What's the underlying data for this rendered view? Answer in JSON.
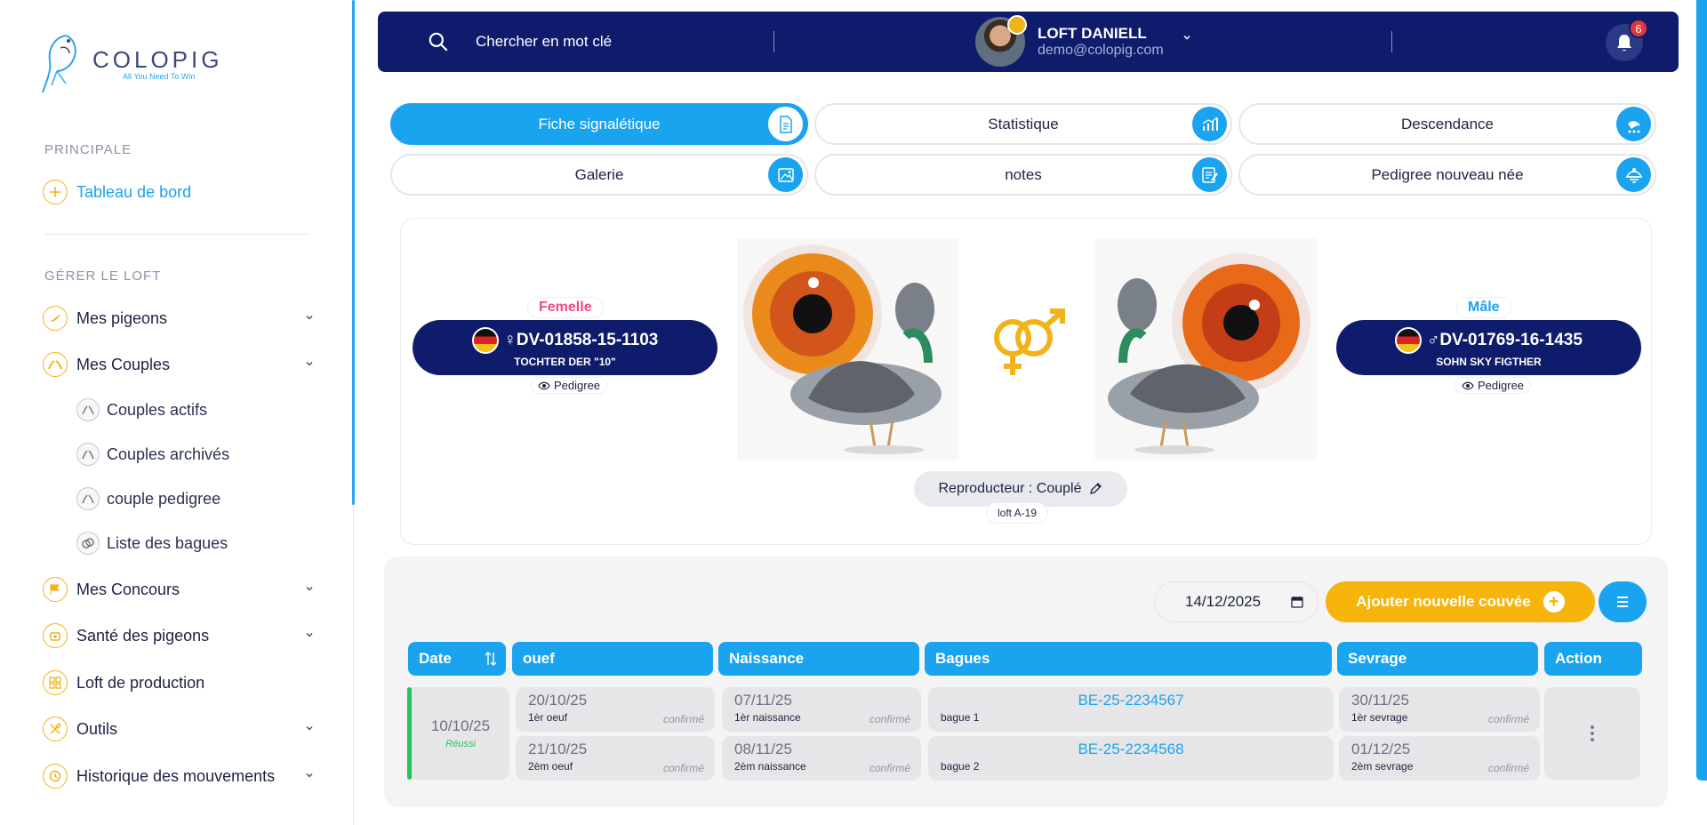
{
  "brand": {
    "title": "COLOPIG",
    "tagline": "All You Need To Win"
  },
  "sidebar": {
    "section_main": "PRINCIPALE",
    "dashboard": "Tableau de bord",
    "section_loft": "GÉRER LE LOFT",
    "items": [
      {
        "label": "Mes pigeons"
      },
      {
        "label": "Mes Couples"
      },
      {
        "label": "Mes Concours"
      },
      {
        "label": "Santé des pigeons"
      },
      {
        "label": "Loft de production"
      },
      {
        "label": "Outils"
      },
      {
        "label": "Historique des mouvements"
      }
    ],
    "couples_sub": [
      {
        "label": "Couples actifs"
      },
      {
        "label": "Couples archivés"
      },
      {
        "label": "couple pedigree"
      },
      {
        "label": "Liste des bagues"
      }
    ]
  },
  "topbar": {
    "search_placeholder": "Chercher en mot clé",
    "user_name": "LOFT DANIELL",
    "user_email": "demo@colopig.com",
    "notifications": "6"
  },
  "tabs": [
    {
      "label": "Fiche signalétique",
      "icon": "document-icon",
      "active": true
    },
    {
      "label": "Statistique",
      "icon": "chart-icon"
    },
    {
      "label": "Descendance",
      "icon": "descendance-icon"
    },
    {
      "label": "Galerie",
      "icon": "gallery-icon"
    },
    {
      "label": "notes",
      "icon": "notes-icon"
    },
    {
      "label": "Pedigree nouveau née",
      "icon": "pedigree-icon"
    }
  ],
  "couple": {
    "female": {
      "sex_label": "Femelle",
      "ring": "♀DV-01858-15-1103",
      "name": "TOCHTER DER \"10\"",
      "pedigree": "Pedigree"
    },
    "male": {
      "sex_label": "Mâle",
      "ring": "♂DV-01769-16-1435",
      "name": "SOHN SKY FIGTHER",
      "pedigree": "Pedigree"
    },
    "status": "Reproducteur : Couplé",
    "loft": "loft A-19"
  },
  "brood": {
    "date_value": "14/12/2025",
    "add_button": "Ajouter nouvelle couvée",
    "headers": [
      "Date",
      "ouef",
      "Naissance",
      "Bagues",
      "Sevrage",
      "Action"
    ],
    "row": {
      "date": "10/10/25",
      "status": "Réussi",
      "eggs": [
        {
          "value": "20/10/25",
          "label": "1èr oeuf",
          "state": "confirmé"
        },
        {
          "value": "21/10/25",
          "label": "2èm oeuf",
          "state": "confirmé"
        }
      ],
      "births": [
        {
          "value": "07/11/25",
          "label": "1èr naissance",
          "state": "confirmé"
        },
        {
          "value": "08/11/25",
          "label": "2èm naissance",
          "state": "confirmé"
        }
      ],
      "rings": [
        {
          "value": "BE-25-2234567",
          "label": "bague 1"
        },
        {
          "value": "BE-25-2234568",
          "label": "bague 2"
        }
      ],
      "weaning": [
        {
          "value": "30/11/25",
          "label": "1èr sevrage",
          "state": "confirmé"
        },
        {
          "value": "01/12/25",
          "label": "2èm sevrage",
          "state": "confirmé"
        }
      ]
    }
  },
  "colors": {
    "navy": "#0f1c6b",
    "blue": "#1aa3ef",
    "amber": "#f7b40a",
    "pink": "#f04a7a",
    "green": "#22c55e"
  }
}
